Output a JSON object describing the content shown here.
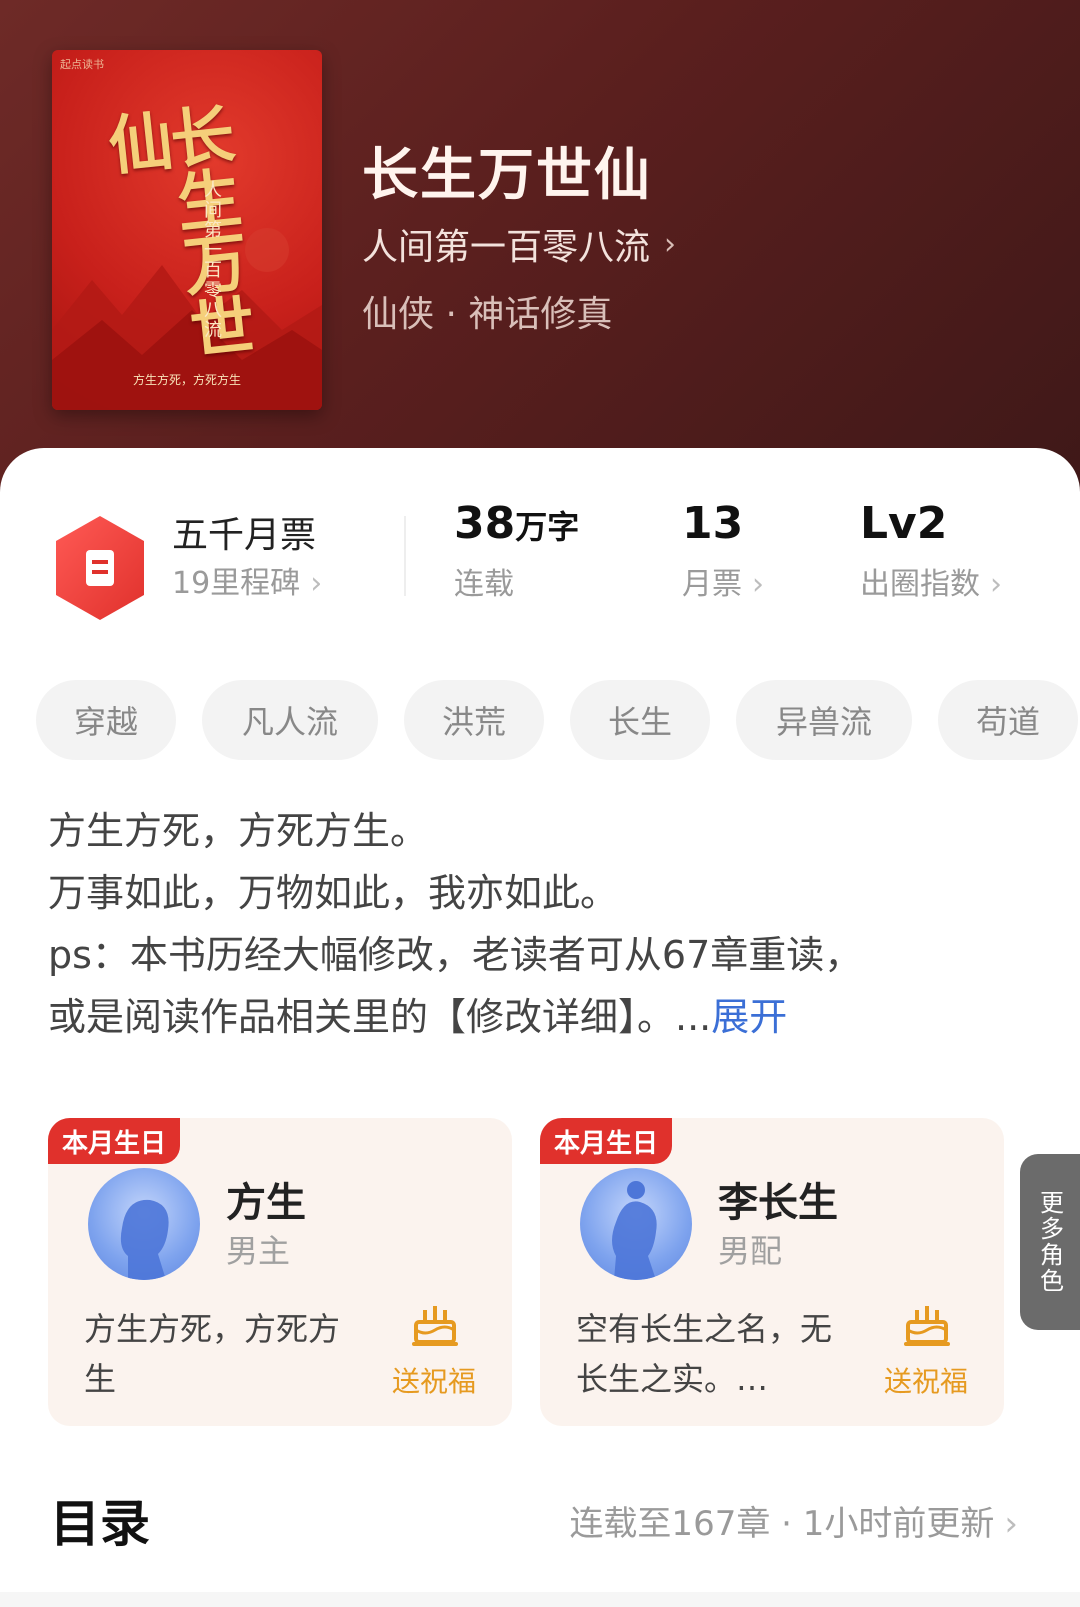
{
  "book": {
    "cover_title": "长生万世仙",
    "cover_subtitle": "人间第一百零八流",
    "cover_slogan": "方生方死，方死方生",
    "title": "长生万世仙",
    "author": "人间第一百零八流",
    "genre": "仙侠 · 神话修真"
  },
  "stats": {
    "ticket_title": "五千月票",
    "ticket_sub": "19里程碑",
    "words_value": "38",
    "words_unit": "万字",
    "words_label": "连载",
    "monthly_value": "13",
    "monthly_label": "月票",
    "index_value": "Lv2",
    "index_label": "出圈指数"
  },
  "tags": [
    "穿越",
    "凡人流",
    "洪荒",
    "长生",
    "异兽流",
    "苟道"
  ],
  "description": {
    "lines": [
      "方生方死，方死方生。",
      "万事如此，万物如此，我亦如此。",
      "ps：本书历经大幅修改，老读者可从67章重读，",
      "或是阅读作品相关里的【修改详细】。..."
    ],
    "expand": "展开"
  },
  "characters": [
    {
      "badge": "本月生日",
      "name": "方生",
      "role": "男主",
      "quote": "方生方死，方死方生",
      "wish": "送祝福"
    },
    {
      "badge": "本月生日",
      "name": "李长生",
      "role": "男配",
      "quote": "空有长生之名，无长生之实。…",
      "wish": "送祝福"
    }
  ],
  "more_roles": "更多角色",
  "catalog": {
    "title": "目录",
    "info": "连载至167章 · 1小时前更新"
  },
  "colors": {
    "header_bg": "#5a1f1e",
    "accent_red": "#e0312c",
    "link_blue": "#3b6fd6",
    "wish_orange": "#e69a20"
  }
}
